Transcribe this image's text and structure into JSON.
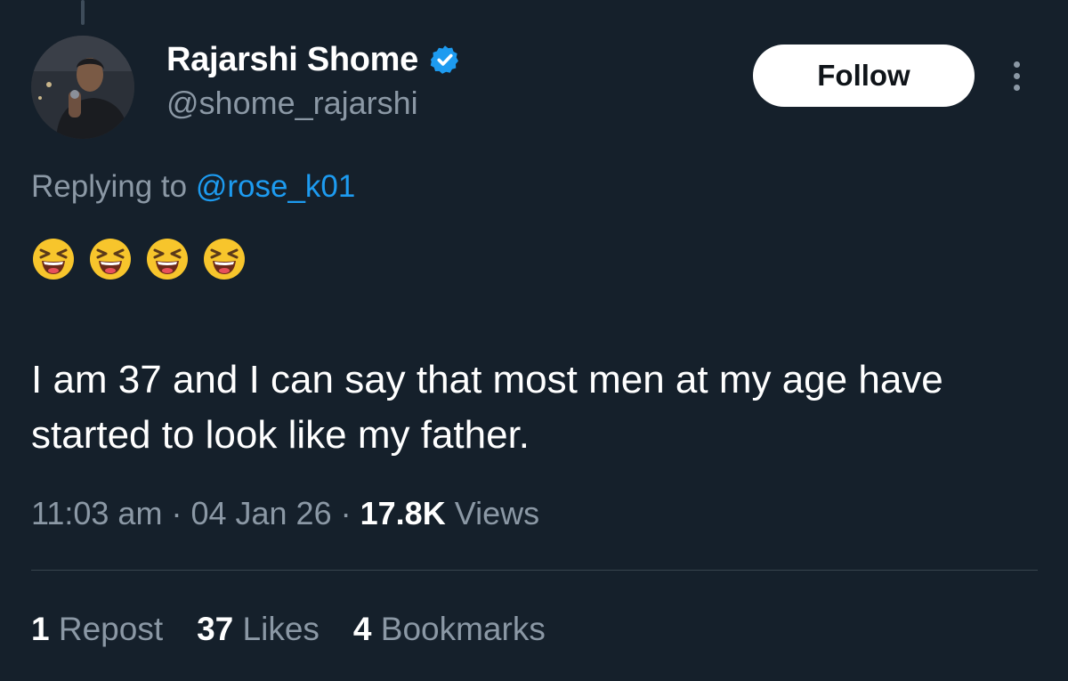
{
  "author": {
    "display_name": "Rajarshi Shome",
    "handle": "@shome_rajarshi",
    "verified_icon": "verified-badge-icon"
  },
  "actions": {
    "follow_label": "Follow",
    "more_icon": "more-options-icon"
  },
  "reply": {
    "prefix": "Replying to ",
    "mention": "@rose_k01"
  },
  "tweet": {
    "emojis": [
      "laughing-face-emoji",
      "laughing-face-emoji",
      "laughing-face-emoji",
      "laughing-face-emoji"
    ],
    "text": "I am 37 and I can say that most men at my age have started to look like my father."
  },
  "meta": {
    "time": "11:03 am",
    "separator": "·",
    "date": "04 Jan 26",
    "views_count": "17.8K",
    "views_label": "Views"
  },
  "stats": {
    "reposts_count": "1",
    "reposts_label": "Repost",
    "likes_count": "37",
    "likes_label": "Likes",
    "bookmarks_count": "4",
    "bookmarks_label": "Bookmarks"
  },
  "colors": {
    "background": "#15202b",
    "accent": "#1d9bf0",
    "secondary_text": "#8b98a5"
  }
}
